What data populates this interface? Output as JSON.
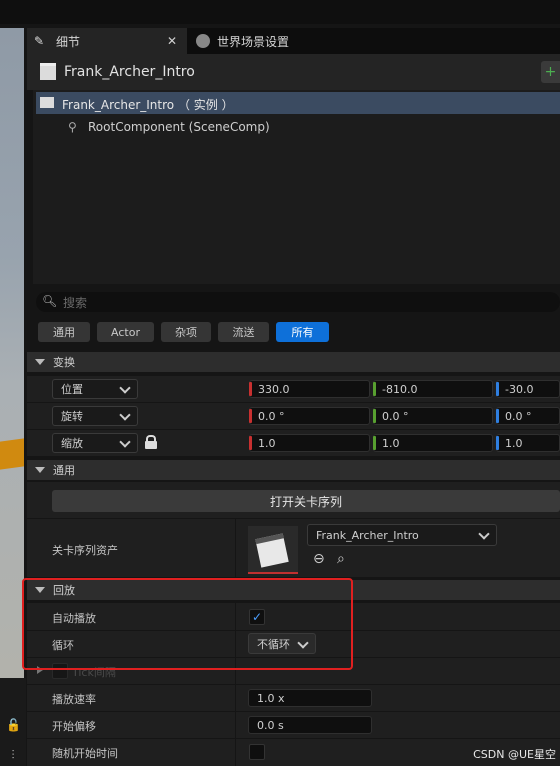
{
  "tabs": [
    {
      "label": "细节",
      "icon": "pencil-icon"
    },
    {
      "label": "世界场景设置",
      "icon": "globe-icon"
    }
  ],
  "actor": {
    "name": "Frank_Archer_Intro",
    "icon": "clapperboard-icon"
  },
  "tree": {
    "instance": "Frank_Archer_Intro （ 实例 ）",
    "root": "RootComponent (SceneComp)"
  },
  "search": {
    "placeholder": "搜索"
  },
  "filters": [
    "通用",
    "Actor",
    "杂项",
    "流送",
    "所有"
  ],
  "transform": {
    "title": "变换",
    "rows": [
      {
        "mode": "位置",
        "x": "330.0",
        "y": "-810.0",
        "z": "-30.0"
      },
      {
        "mode": "旋转",
        "x": "0.0 °",
        "y": "0.0 °",
        "z": "0.0 °"
      },
      {
        "mode": "缩放",
        "x": "1.0",
        "y": "1.0",
        "z": "1.0"
      }
    ]
  },
  "general": {
    "title": "通用",
    "open_button": "打开关卡序列",
    "asset_label": "关卡序列资产",
    "asset_value": "Frank_Archer_Intro"
  },
  "playback": {
    "title": "回放",
    "autoplay_label": "自动播放",
    "autoplay_checked": true,
    "loop_label": "循环",
    "loop_value": "不循环",
    "tick_label": "Tick间隔",
    "rate_label": "播放速率",
    "rate_value": "1.0 x",
    "offset_label": "开始偏移",
    "offset_value": "0.0 s",
    "random_label": "随机开始时间"
  },
  "watermark": "CSDN @UE星空",
  "colors": {
    "accent": "#0e70d9",
    "x_axis": "#c83030",
    "y_axis": "#58a030",
    "z_axis": "#2f7fe0",
    "highlight_box": "#e02020"
  }
}
